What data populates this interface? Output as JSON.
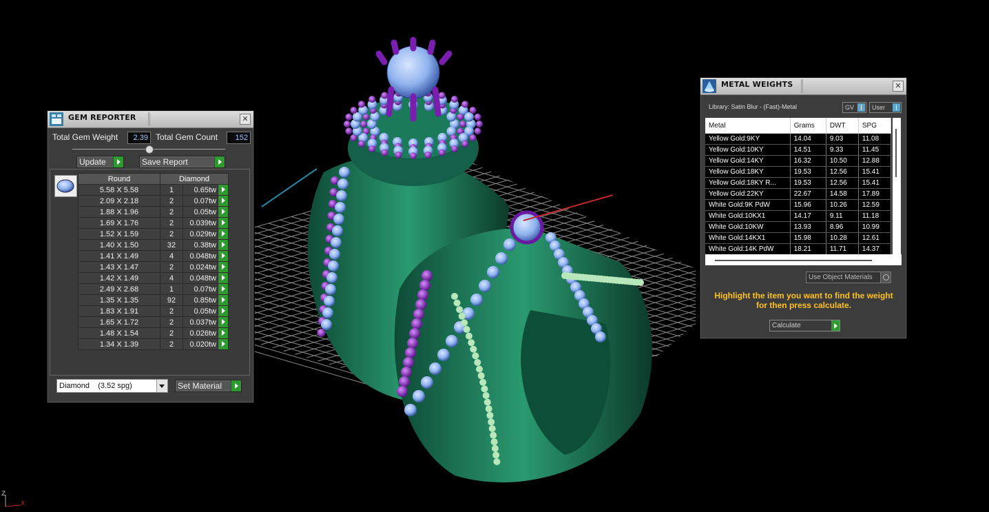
{
  "gem_reporter": {
    "title": "GEM REPORTER",
    "total_weight_label": "Total Gem Weight",
    "total_weight_value": "2.39",
    "total_count_label": "Total Gem Count",
    "total_count_value": "152",
    "update_label": "Update",
    "save_report_label": "Save Report",
    "columns": {
      "shape": "Round",
      "material": "Diamond"
    },
    "rows": [
      {
        "size": "5.58 X 5.58",
        "count": "1",
        "weight": "0.65tw"
      },
      {
        "size": "2.09 X 2.18",
        "count": "2",
        "weight": "0.07tw"
      },
      {
        "size": "1.88 X 1.96",
        "count": "2",
        "weight": "0.05tw"
      },
      {
        "size": "1.69 X 1.76",
        "count": "2",
        "weight": "0.039tw"
      },
      {
        "size": "1.52 X 1.59",
        "count": "2",
        "weight": "0.029tw"
      },
      {
        "size": "1.40 X 1.50",
        "count": "32",
        "weight": "0.38tw"
      },
      {
        "size": "1.41 X 1.49",
        "count": "4",
        "weight": "0.048tw"
      },
      {
        "size": "1.43 X 1.47",
        "count": "2",
        "weight": "0.024tw"
      },
      {
        "size": "1.42 X 1.49",
        "count": "4",
        "weight": "0.048tw"
      },
      {
        "size": "2.49 X 2.68",
        "count": "1",
        "weight": "0.07tw"
      },
      {
        "size": "1.35 X 1.35",
        "count": "92",
        "weight": "0.85tw"
      },
      {
        "size": "1.83 X 1.91",
        "count": "2",
        "weight": "0.05tw"
      },
      {
        "size": "1.65 X 1.72",
        "count": "2",
        "weight": "0.037tw"
      },
      {
        "size": "1.48 X 1.54",
        "count": "2",
        "weight": "0.026tw"
      },
      {
        "size": "1.34 X 1.39",
        "count": "2",
        "weight": "0.020tw"
      }
    ],
    "material_select": "Diamond    (3.52 spg)",
    "set_material_label": "Set Material"
  },
  "metal_weights": {
    "title": "METAL WEIGHTS",
    "library": "Library: Satin Blur - (Fast)-Metal",
    "gv_label": "GV",
    "user_label": "User",
    "columns": [
      "Metal",
      "Grams",
      "DWT",
      "SPG"
    ],
    "rows": [
      {
        "metal": "Yellow Gold:9KY",
        "grams": "14.04",
        "dwt": "9.03",
        "spg": "11.08"
      },
      {
        "metal": "Yellow Gold:10KY",
        "grams": "14.51",
        "dwt": "9.33",
        "spg": "11.45"
      },
      {
        "metal": "Yellow Gold:14KY",
        "grams": "16.32",
        "dwt": "10.50",
        "spg": "12.88"
      },
      {
        "metal": "Yellow Gold:18KY",
        "grams": "19.53",
        "dwt": "12.56",
        "spg": "15.41"
      },
      {
        "metal": "Yellow Gold:18KY R...",
        "grams": "19.53",
        "dwt": "12.56",
        "spg": "15.41"
      },
      {
        "metal": "Yellow Gold:22KY",
        "grams": "22.67",
        "dwt": "14.58",
        "spg": "17.89"
      },
      {
        "metal": "White Gold:9K PdW",
        "grams": "15.96",
        "dwt": "10.26",
        "spg": "12.59"
      },
      {
        "metal": "White Gold:10KX1",
        "grams": "14.17",
        "dwt": "9.11",
        "spg": "11.18"
      },
      {
        "metal": "White Gold:10KW",
        "grams": "13.93",
        "dwt": "8.96",
        "spg": "10.99"
      },
      {
        "metal": "White Gold:14KX1",
        "grams": "15.98",
        "dwt": "10.28",
        "spg": "12.61"
      },
      {
        "metal": "White Gold:14K PdW",
        "grams": "18.21",
        "dwt": "11.71",
        "spg": "14.37"
      }
    ],
    "use_object_materials": "Use Object Materials",
    "message": "Highlight the item you want to find the weight for then press calculate.",
    "calculate_label": "Calculate"
  },
  "axis": {
    "z": "Z",
    "x": "X"
  },
  "colors": {
    "ring_green": "#1f7a5a",
    "ring_light": "#9fd8a8",
    "gem_blue": "#8fb3ee",
    "prong_purple": "#8a2fc0",
    "grid": "#9a9a9a",
    "accent_orange": "#ffc21a"
  }
}
